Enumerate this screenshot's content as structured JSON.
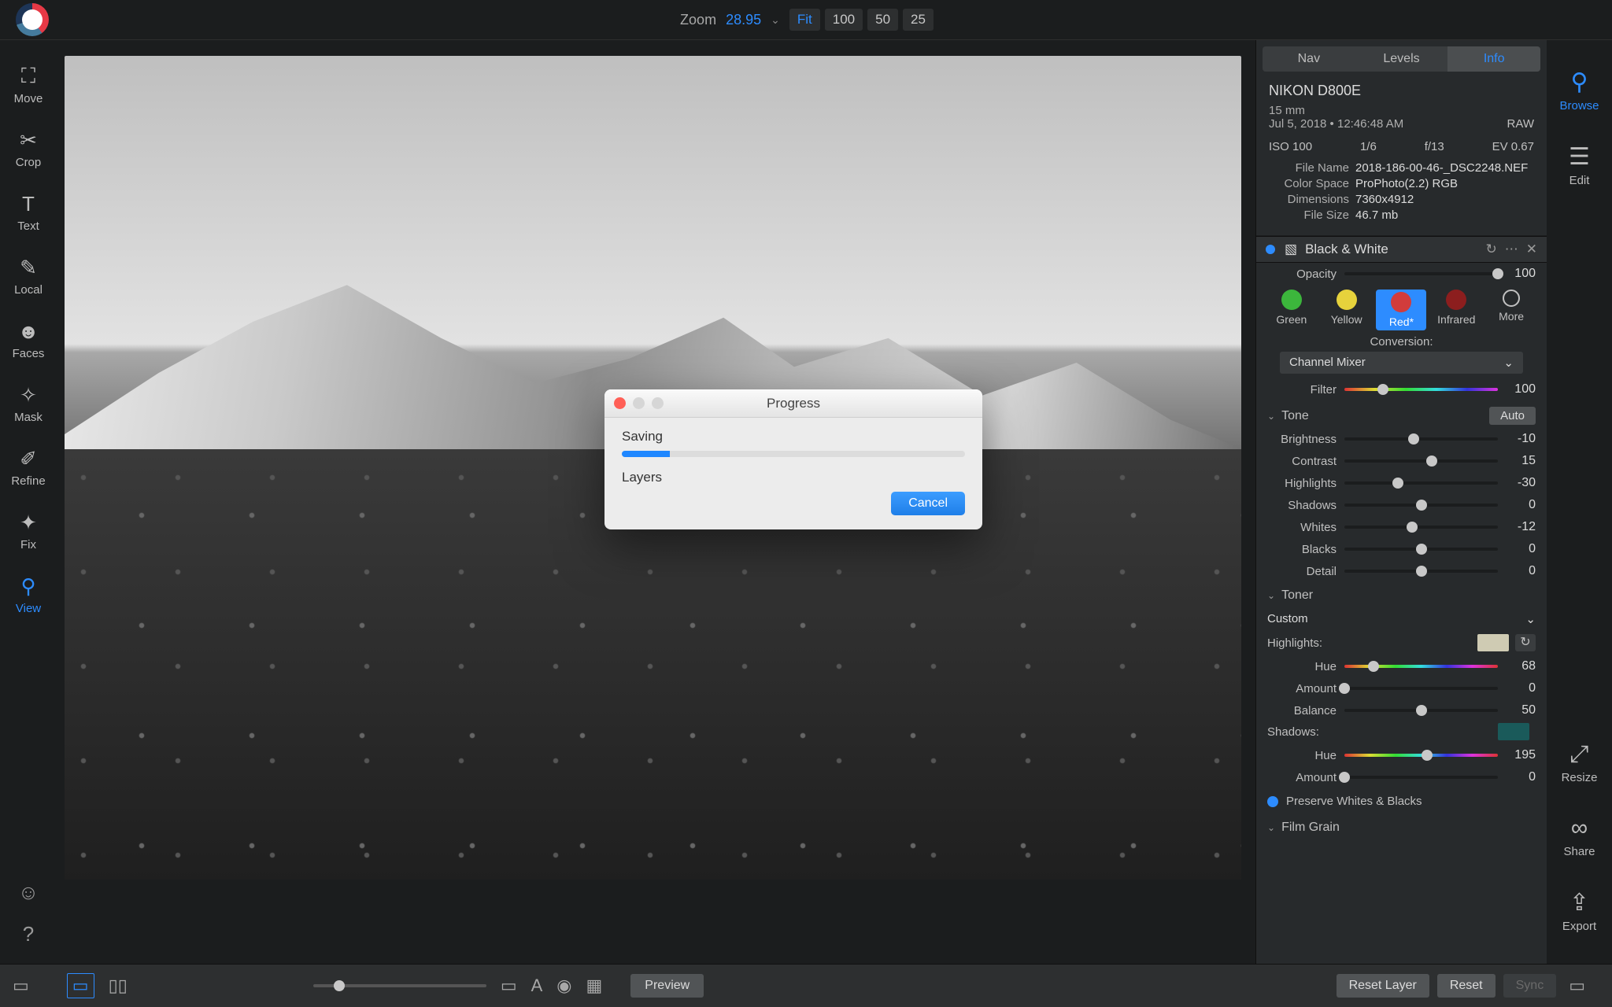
{
  "top": {
    "zoom_label": "Zoom",
    "zoom_value": "28.95",
    "fit": "Fit",
    "z100": "100",
    "z50": "50",
    "z25": "25"
  },
  "left_tools": {
    "move": "Move",
    "crop": "Crop",
    "text": "Text",
    "local": "Local",
    "faces": "Faces",
    "mask": "Mask",
    "refine": "Refine",
    "fix": "Fix",
    "view": "View"
  },
  "right_tools": {
    "browse": "Browse",
    "edit": "Edit",
    "resize": "Resize",
    "share": "Share",
    "export": "Export"
  },
  "tabs": {
    "nav": "Nav",
    "levels": "Levels",
    "info": "Info"
  },
  "info": {
    "camera": "NIKON D800E",
    "focal": "15 mm",
    "datetime": "Jul 5, 2018 • 12:46:48 AM",
    "raw": "RAW",
    "iso": "ISO 100",
    "shutter": "1/6",
    "aperture": "f/13",
    "ev": "EV 0.67",
    "filename_k": "File Name",
    "filename_v": "2018-186-00-46-_DSC2248.NEF",
    "colorspace_k": "Color Space",
    "colorspace_v": "ProPhoto(2.2) RGB",
    "dims_k": "Dimensions",
    "dims_v": "7360x4912",
    "filesize_k": "File Size",
    "filesize_v": "46.7 mb"
  },
  "bw": {
    "title": "Black & White",
    "opacity_lbl": "Opacity",
    "opacity_val": "100",
    "green": "Green",
    "yellow": "Yellow",
    "red": "Red*",
    "infrared": "Infrared",
    "more": "More",
    "conversion_lbl": "Conversion:",
    "conversion_sel": "Channel Mixer",
    "filter_lbl": "Filter",
    "filter_val": "100",
    "tone_lbl": "Tone",
    "auto": "Auto",
    "brightness_lbl": "Brightness",
    "brightness_val": "-10",
    "contrast_lbl": "Contrast",
    "contrast_val": "15",
    "highlights_lbl": "Highlights",
    "highlights_val": "-30",
    "shadows_lbl": "Shadows",
    "shadows_val": "0",
    "whites_lbl": "Whites",
    "whites_val": "-12",
    "blacks_lbl": "Blacks",
    "blacks_val": "0",
    "detail_lbl": "Detail",
    "detail_val": "0",
    "toner_lbl": "Toner",
    "toner_sel": "Custom",
    "hl_lbl": "Highlights:",
    "hue_lbl": "Hue",
    "hl_hue_val": "68",
    "amount_lbl": "Amount",
    "hl_amount_val": "0",
    "balance_lbl": "Balance",
    "balance_val": "50",
    "sh_lbl": "Shadows:",
    "sh_hue_val": "195",
    "sh_amount_val": "0",
    "preserve": "Preserve Whites & Blacks",
    "filmgrain": "Film Grain"
  },
  "bottom": {
    "preview": "Preview",
    "reset_layer": "Reset Layer",
    "reset": "Reset",
    "sync": "Sync"
  },
  "dialog": {
    "title": "Progress",
    "saving": "Saving",
    "layers": "Layers",
    "cancel": "Cancel",
    "progress_pct": 14
  }
}
